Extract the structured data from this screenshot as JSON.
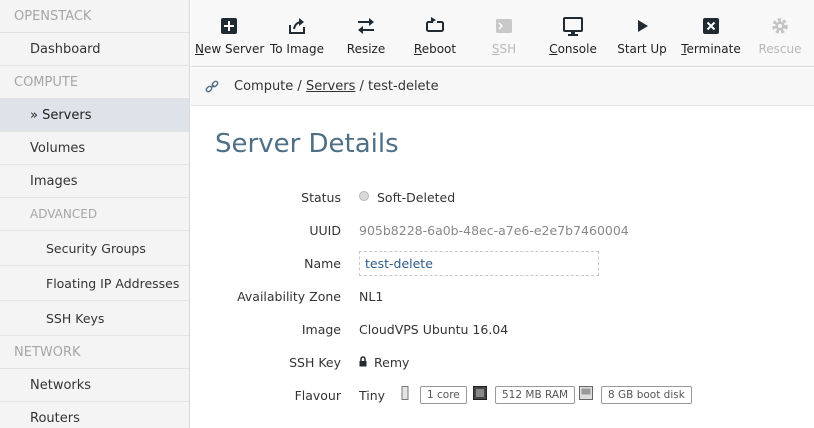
{
  "sidebar": {
    "sections": [
      {
        "header": "OPENSTACK",
        "items": [
          "Dashboard"
        ]
      },
      {
        "header": "COMPUTE",
        "items": [
          "» Servers",
          "Volumes",
          "Images"
        ]
      },
      {
        "subheader": "ADVANCED",
        "items": [
          "Security Groups",
          "Floating IP Addresses",
          "SSH Keys"
        ]
      },
      {
        "header": "NETWORK",
        "items": [
          "Networks",
          "Routers"
        ]
      }
    ]
  },
  "toolbar": {
    "buttons": [
      {
        "label": "New Server",
        "icon": "plus-square-icon",
        "enabled": true
      },
      {
        "label": "To Image",
        "icon": "export-icon",
        "enabled": true
      },
      {
        "label": "Resize",
        "icon": "resize-arrows-icon",
        "enabled": true
      },
      {
        "label": "Reboot",
        "icon": "reboot-icon",
        "enabled": true
      },
      {
        "label": "SSH",
        "icon": "terminal-icon",
        "enabled": false
      },
      {
        "label": "Console",
        "icon": "monitor-icon",
        "enabled": true
      },
      {
        "label": "Start Up",
        "icon": "play-icon",
        "enabled": true
      },
      {
        "label": "Terminate",
        "icon": "close-square-icon",
        "enabled": true
      },
      {
        "label": "Rescue",
        "icon": "gear-icon",
        "enabled": false
      }
    ]
  },
  "breadcrumb": {
    "root": "Compute",
    "sep": "/",
    "link": "Servers",
    "current": "test-delete"
  },
  "page": {
    "title": "Server Details"
  },
  "details": {
    "status_label": "Status",
    "status_value": "Soft-Deleted",
    "uuid_label": "UUID",
    "uuid_value": "905b8228-6a0b-48ec-a7e6-e2e7b7460004",
    "name_label": "Name",
    "name_value": "test-delete",
    "az_label": "Availability Zone",
    "az_value": "NL1",
    "image_label": "Image",
    "image_value": "CloudVPS Ubuntu 16.04",
    "sshkey_label": "SSH Key",
    "sshkey_value": "Remy",
    "flavour_label": "Flavour",
    "flavour_value": "Tiny",
    "flavour_cpu": "1 core",
    "flavour_ram": "512 MB RAM",
    "flavour_disk": "8 GB boot disk"
  },
  "colors": {
    "title": "#4e6f86",
    "sidebar_bg": "#f4f4f4",
    "active_item_bg": "#dde3e8",
    "link": "#2d5b8a"
  }
}
